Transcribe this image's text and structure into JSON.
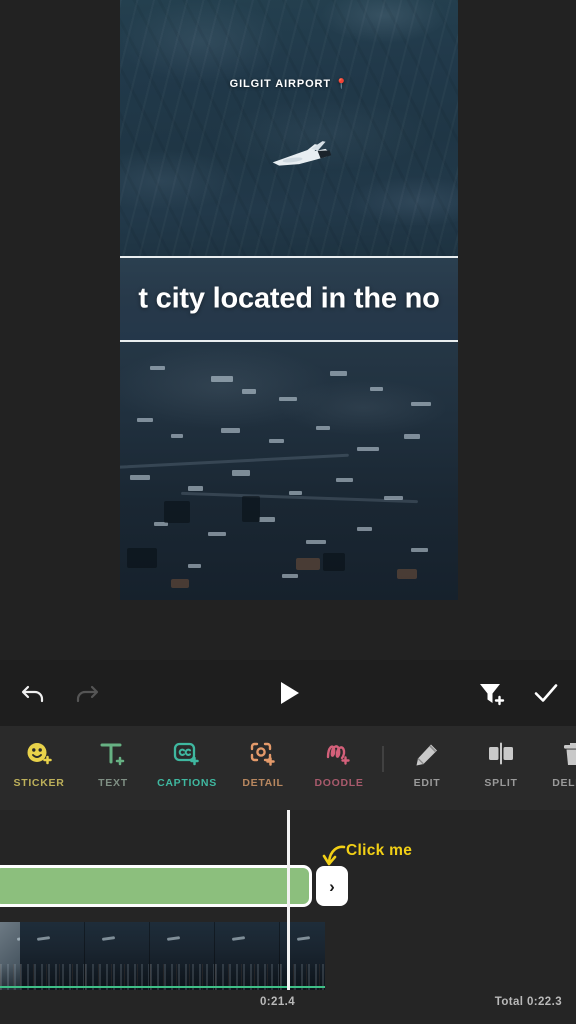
{
  "app": {
    "background": "#222222",
    "accent_yellow": "#f2d016",
    "clip_green": "#8cbf7d"
  },
  "preview": {
    "overlay_title": "GILGIT AIRPORT",
    "overlay_pin": "📍",
    "caption_text": "t city located in the no",
    "plane_icon": "airplane-icon"
  },
  "action_bar": {
    "undo": {
      "name": "undo-icon",
      "label": "Undo",
      "enabled": true
    },
    "redo": {
      "name": "redo-icon",
      "label": "Redo",
      "enabled": false
    },
    "play": {
      "name": "play-icon",
      "label": "Play"
    },
    "filter": {
      "name": "filter-add-icon",
      "label": "Add Filter"
    },
    "done": {
      "name": "checkmark-icon",
      "label": "Done"
    }
  },
  "toolbar": {
    "items": [
      {
        "label": "STICKER",
        "icon": "smiley-plus-icon",
        "color": "#e8d24a"
      },
      {
        "label": "TEXT",
        "icon": "text-plus-icon",
        "color": "#67b183"
      },
      {
        "label": "CAPTIONS",
        "icon": "captions-plus-icon",
        "color": "#3fb8a0"
      },
      {
        "label": "DETAIL",
        "icon": "focus-plus-icon",
        "color": "#e49a6a"
      },
      {
        "label": "DOODLE",
        "icon": "scribble-plus-icon",
        "color": "#d4607a"
      },
      {
        "label": "EDIT",
        "icon": "pencil-icon",
        "color": "#9a9a9a"
      },
      {
        "label": "SPLIT",
        "icon": "split-icon",
        "color": "#9a9a9a"
      },
      {
        "label": "DELETE",
        "icon": "trash-icon",
        "color": "#9a9a9a"
      }
    ]
  },
  "timeline": {
    "clip_next_chevron": "›",
    "hint_text": "Click me",
    "hint_arrow": "curved-arrow-down-icon",
    "current_time": "0:21.4",
    "total_time": "Total 0:22.3",
    "clip_color": "#8cbf7d",
    "audio_track_color": "#3fbf87"
  }
}
